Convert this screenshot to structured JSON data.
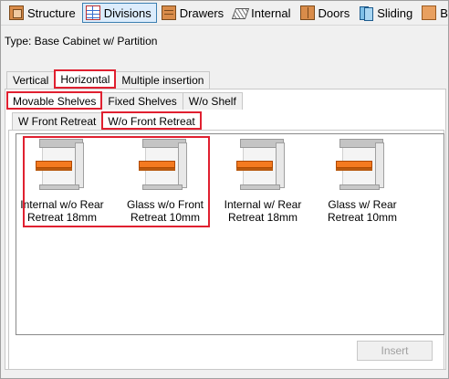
{
  "toolbar": {
    "items": [
      {
        "label": "Structure",
        "icon": "structure-icon"
      },
      {
        "label": "Divisions",
        "icon": "divisions-icon",
        "active": true
      },
      {
        "label": "Drawers",
        "icon": "drawers-icon"
      },
      {
        "label": "Internal",
        "icon": "internal-icon"
      },
      {
        "label": "Doors",
        "icon": "doors-icon"
      },
      {
        "label": "Sliding",
        "icon": "sliding-icon"
      },
      {
        "label": "Back Panel",
        "icon": "back-panel-icon"
      }
    ]
  },
  "type_label": "Type: Base Cabinet w/ Partition",
  "tabs_level1": [
    "Vertical",
    "Horizontal",
    "Multiple insertion"
  ],
  "tabs_level2": [
    "Movable Shelves",
    "Fixed Shelves",
    "W/o Shelf"
  ],
  "tabs_level3": [
    "W Front Retreat",
    "W/o Front Retreat"
  ],
  "items": [
    {
      "line1": "Internal w/o Rear",
      "line2": "Retreat 18mm"
    },
    {
      "line1": "Glass w/o Front",
      "line2": "Retreat 10mm"
    },
    {
      "line1": "Internal w/ Rear",
      "line2": "Retreat 18mm"
    },
    {
      "line1": "Glass w/ Rear",
      "line2": "Retreat 10mm"
    }
  ],
  "insert_button": "Insert",
  "colors": {
    "highlight": "#e02030",
    "shelf": "#f47a20",
    "active_border": "#3c7fb1"
  }
}
